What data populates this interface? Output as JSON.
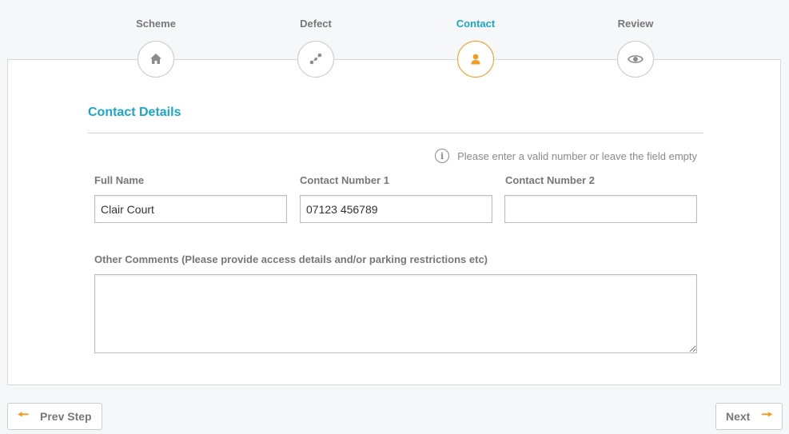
{
  "steps": [
    {
      "label": "Scheme",
      "icon": "home-icon"
    },
    {
      "label": "Defect",
      "icon": "route-icon"
    },
    {
      "label": "Contact",
      "icon": "person-icon",
      "active": true
    },
    {
      "label": "Review",
      "icon": "eye-icon"
    }
  ],
  "section": {
    "title": "Contact Details",
    "hint": "Please enter a valid number or leave the field empty",
    "hint_icon": "info-icon"
  },
  "fields": {
    "full_name": {
      "label": "Full Name",
      "value": "Clair Court"
    },
    "contact1": {
      "label": "Contact Number 1",
      "value": "07123 456789"
    },
    "contact2": {
      "label": "Contact Number 2",
      "value": ""
    },
    "comments": {
      "label": "Other Comments (Please provide access details and/or parking restrictions etc)",
      "value": ""
    }
  },
  "nav": {
    "prev_label": "Prev Step",
    "next_label": "Next"
  },
  "colors": {
    "accent": "#1ba6c9",
    "active_step": "#f39a1f",
    "arrow": "#f39a1f"
  }
}
